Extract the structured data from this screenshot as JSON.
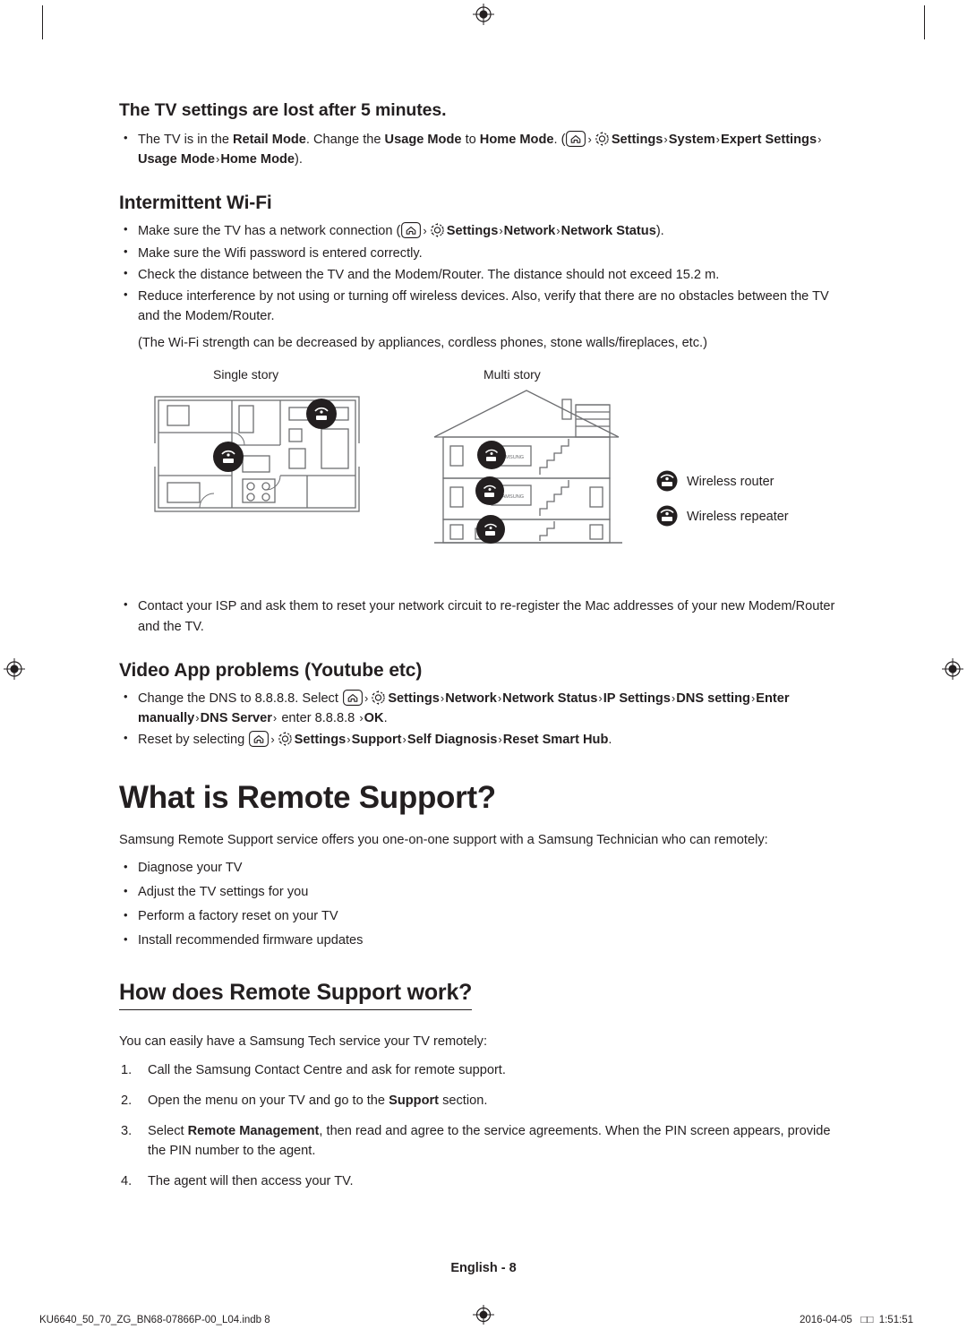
{
  "section_tv_settings": {
    "heading": "The TV settings are lost after 5 minutes.",
    "bullet": {
      "p1": "The TV is in the ",
      "retail_mode": "Retail Mode",
      "p2": ". Change the ",
      "usage_mode": "Usage Mode",
      "p3": " to ",
      "home_mode": "Home Mode",
      "p4": ". (",
      "settings": "Settings",
      "system": "System",
      "expert_settings": "Expert Settings",
      "usage_mode2": "Usage Mode",
      "home_mode2": "Home Mode",
      "p5": ")."
    }
  },
  "section_wifi": {
    "heading": "Intermittent Wi-Fi",
    "bullet1": {
      "p1": "Make sure the TV has a network connection (",
      "settings": "Settings",
      "network": "Network",
      "network_status": "Network Status",
      "p2": ")."
    },
    "bullet2": "Make sure the Wifi password is entered correctly.",
    "bullet3": "Check the distance between the TV and the Modem/Router. The distance should not exceed 15.2 m.",
    "bullet4": "Reduce interference by not using or turning off wireless devices. Also, verify that there are no obstacles between the TV and the Modem/Router.",
    "note": "(The Wi-Fi strength can be decreased by appliances, cordless phones, stone walls/fireplaces, etc.)",
    "figure": {
      "caption_single": "Single story",
      "caption_multi": "Multi story",
      "legend_router": "Wireless router",
      "legend_repeater": "Wireless repeater",
      "tv_brand": "SAMSUNG"
    },
    "bullet5": "Contact your ISP and ask them to reset your network circuit to re-register the Mac addresses of your new Modem/Router and the TV."
  },
  "section_video_app": {
    "heading": "Video App problems (Youtube etc)",
    "bullet1": {
      "p1": "Change the DNS to 8.8.8.8. Select ",
      "settings": "Settings",
      "network": "Network",
      "network_status": "Network Status",
      "ip_settings": "IP Settings",
      "dns_setting": "DNS setting",
      "enter_manually": "Enter manually",
      "dns_server": "DNS Server",
      "p2": " enter 8.8.8.8 ",
      "ok": "OK",
      "p3": "."
    },
    "bullet2": {
      "p1": "Reset by selecting ",
      "settings": "Settings",
      "support": "Support",
      "self_diagnosis": "Self Diagnosis",
      "reset_smart_hub": "Reset Smart Hub",
      "p2": "."
    }
  },
  "section_remote_support": {
    "heading": "What is Remote Support?",
    "intro": "Samsung Remote Support service offers you one-on-one support with a Samsung Technician who can remotely:",
    "items": [
      "Diagnose your TV",
      "Adjust the TV settings for you",
      "Perform a factory reset on your TV",
      "Install recommended firmware updates"
    ]
  },
  "section_how_works": {
    "heading": "How does Remote Support work?",
    "intro": "You can easily have a Samsung Tech service your TV remotely:",
    "steps": [
      {
        "p1": "Call the Samsung Contact Centre and ask for remote support."
      },
      {
        "p1": "Open the menu on your TV and go to the ",
        "b": "Support",
        "p2": " section."
      },
      {
        "p1": "Select ",
        "b": "Remote Management",
        "p2": ", then read and agree to the service agreements. When the PIN screen appears, provide the PIN number to the agent."
      },
      {
        "p1": "The agent will then access your TV."
      }
    ]
  },
  "footer": {
    "language_page": "English - 8",
    "file_name": "KU6640_50_70_ZG_BN68-07866P-00_L04.indb   8",
    "date": "2016-04-05",
    "time": "1:51:51"
  }
}
